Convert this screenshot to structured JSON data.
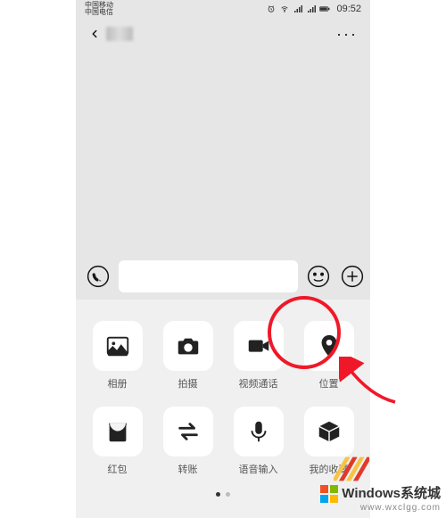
{
  "status": {
    "carrier1": "中国移动",
    "carrier2": "中国电信",
    "time": "09:52"
  },
  "header": {
    "more": "···"
  },
  "input": {
    "value": ""
  },
  "attachments": {
    "row1": [
      {
        "label": "相册",
        "name": "album"
      },
      {
        "label": "拍摄",
        "name": "camera"
      },
      {
        "label": "视频通话",
        "name": "video-call"
      },
      {
        "label": "位置",
        "name": "location"
      }
    ],
    "row2": [
      {
        "label": "红包",
        "name": "red-packet"
      },
      {
        "label": "转账",
        "name": "transfer"
      },
      {
        "label": "语音输入",
        "name": "voice-input"
      },
      {
        "label": "我的收藏",
        "name": "favorites"
      }
    ]
  },
  "watermark": {
    "line1": "Windows系统城",
    "line2": "www.wxclgg.com"
  }
}
